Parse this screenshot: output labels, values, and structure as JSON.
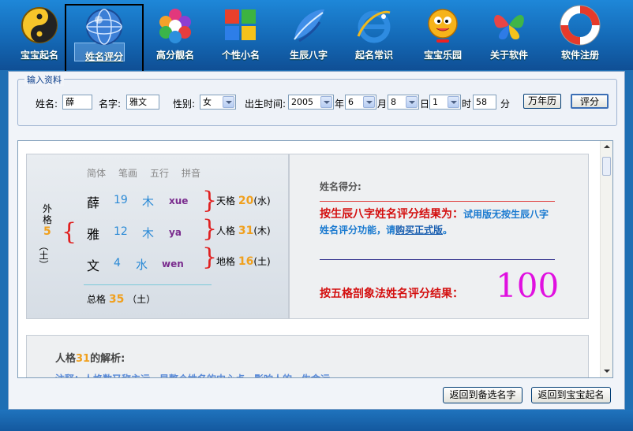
{
  "toolbar": {
    "items": [
      {
        "label": "宝宝起名",
        "icon": "yin-yang-icon"
      },
      {
        "label": "姓名评分",
        "icon": "globe-icon"
      },
      {
        "label": "高分靓名",
        "icon": "hexagon-grid-icon"
      },
      {
        "label": "个性小名",
        "icon": "windows-logo-icon"
      },
      {
        "label": "生辰八字",
        "icon": "leaf-swirl-icon"
      },
      {
        "label": "起名常识",
        "icon": "ie-logo-icon"
      },
      {
        "label": "宝宝乐园",
        "icon": "cartoon-bird-icon"
      },
      {
        "label": "关于软件",
        "icon": "butterfly-icon"
      },
      {
        "label": "软件注册",
        "icon": "lifebuoy-icon"
      }
    ]
  },
  "input": {
    "legend": "输入资料",
    "surname_label": "姓名:",
    "surname_value": "薛",
    "given_label": "名字:",
    "given_value": "雅文",
    "gender_label": "性别:",
    "gender_value": "女",
    "birth_label": "出生时间:",
    "year_value": "2005",
    "year_unit": "年",
    "month_value": "6",
    "month_unit": "月",
    "day_value": "8",
    "day_unit": "日",
    "hour_value": "1",
    "hour_unit": "时",
    "minute_value": "58",
    "minute_unit": "分",
    "calendar_button": "万年历",
    "score_button": "评分"
  },
  "name_card": {
    "headers": [
      "简体",
      "笔画",
      "五行",
      "拼音"
    ],
    "rows": [
      {
        "char": "薛",
        "strokes": "19",
        "element": "木",
        "pinyin": "xue"
      },
      {
        "char": "雅",
        "strokes": "12",
        "element": "木",
        "pinyin": "ya"
      },
      {
        "char": "文",
        "strokes": "4",
        "element": "水",
        "pinyin": "wen"
      }
    ],
    "wai_label_1": "外",
    "wai_label_2": "格",
    "wai_value": "5",
    "wai_element": "（土）",
    "tian_label": "天格",
    "tian_value": "20",
    "tian_element": "(水)",
    "ren_label": "人格",
    "ren_value": "31",
    "ren_element": "(木)",
    "di_label": "地格",
    "di_value": "16",
    "di_element": "(土)",
    "zong_label": "总格",
    "zong_value": "35",
    "zong_element": "（土）"
  },
  "score_card": {
    "title": "姓名得分:",
    "bazi_result": "按生辰八字姓名评分结果为：",
    "bazi_note": "试用版无按生辰八字姓名评分功能，请",
    "bazi_buy": "购买正式版",
    "bazi_end": "。",
    "wuge_result": "按五格剖象法姓名评分结果：",
    "score": "100"
  },
  "analysis": {
    "title_prefix": "人格",
    "title_value": "31",
    "title_suffix": "的解析:",
    "text": "注释：人格数又称主运，是整个姓名的中心点，影响人的一生命运。"
  },
  "bottom": {
    "back_to_candidates": "返回到备选名字",
    "back_to_naming": "返回到宝宝起名"
  }
}
